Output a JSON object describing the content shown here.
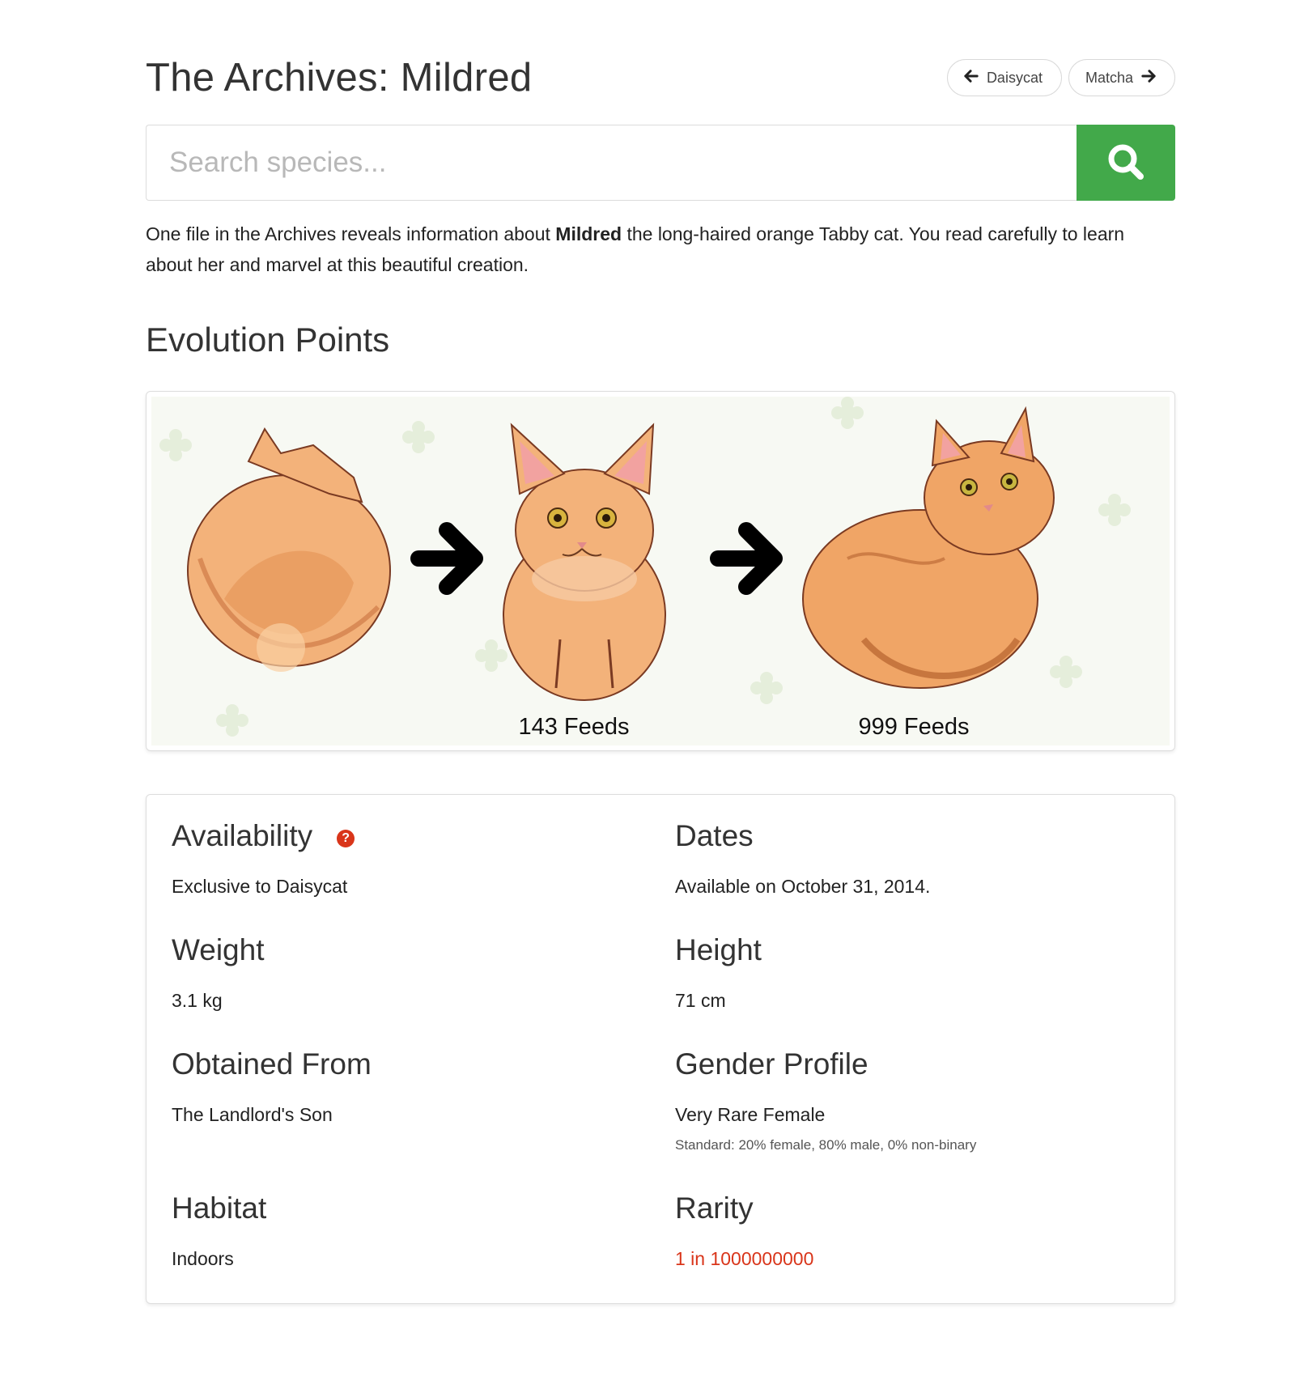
{
  "page": {
    "title": "The Archives: Mildred",
    "nav": {
      "prev_label": "Daisycat",
      "next_label": "Matcha"
    }
  },
  "search": {
    "placeholder": "Search species...",
    "value": ""
  },
  "intro": {
    "before": "One file in the Archives reveals information about ",
    "name": "Mildred",
    "after": " the long-haired orange Tabby cat. You read carefully to learn about her and marvel at this beautiful creation."
  },
  "evolution": {
    "title": "Evolution Points",
    "stages": [
      {
        "label": ""
      },
      {
        "label": "143 Feeds"
      },
      {
        "label": "999 Feeds"
      }
    ]
  },
  "info": {
    "availability": {
      "label": "Availability",
      "value": "Exclusive to Daisycat"
    },
    "dates": {
      "label": "Dates",
      "value": "Available on October 31, 2014."
    },
    "weight": {
      "label": "Weight",
      "value": "3.1 kg"
    },
    "height": {
      "label": "Height",
      "value": "71 cm"
    },
    "obtained": {
      "label": "Obtained From",
      "value": "The Landlord's Son"
    },
    "gender": {
      "label": "Gender Profile",
      "value": "Very Rare Female",
      "note": "Standard: 20% female, 80% male, 0% non-binary"
    },
    "habitat": {
      "label": "Habitat",
      "value": "Indoors"
    },
    "rarity": {
      "label": "Rarity",
      "value": "1 in 1000000000"
    }
  },
  "colors": {
    "accent_green": "#42a94a",
    "rarity_red": "#d9351a",
    "cat_orange": "#f0a566"
  }
}
